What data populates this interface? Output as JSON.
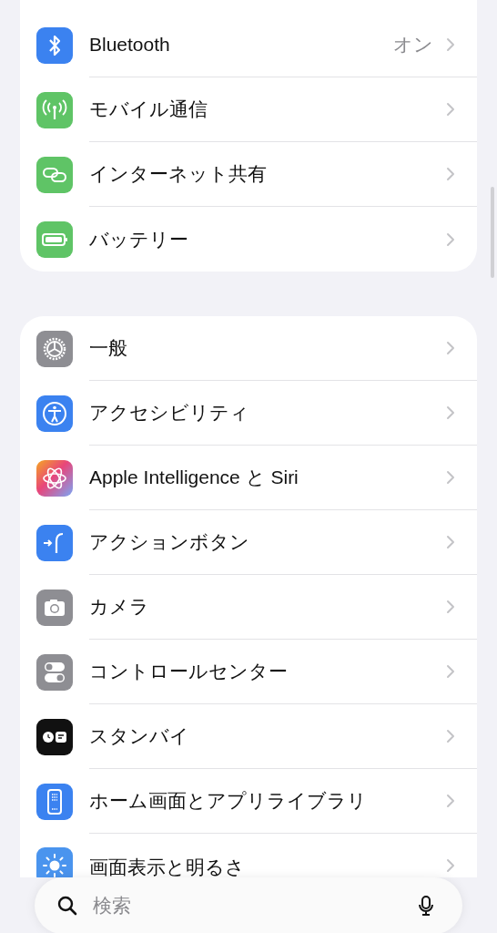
{
  "groups": [
    {
      "items": [
        {
          "label": "Bluetooth",
          "value": "オン",
          "kind": "bluetooth"
        },
        {
          "label": "モバイル通信",
          "kind": "antenna"
        },
        {
          "label": "インターネット共有",
          "kind": "link"
        },
        {
          "label": "バッテリー",
          "kind": "battery"
        }
      ]
    },
    {
      "items": [
        {
          "label": "一般",
          "kind": "gear"
        },
        {
          "label": "アクセシビリティ",
          "kind": "accessibility"
        },
        {
          "label": "Apple Intelligence と Siri",
          "kind": "intelligence"
        },
        {
          "label": "アクションボタン",
          "kind": "action"
        },
        {
          "label": "カメラ",
          "kind": "camera"
        },
        {
          "label": "コントロールセンター",
          "kind": "toggles"
        },
        {
          "label": "スタンバイ",
          "kind": "standby"
        },
        {
          "label": "ホーム画面とアプリライブラリ",
          "kind": "homescreen"
        },
        {
          "label": "画面表示と明るさ",
          "kind": "brightness"
        }
      ]
    }
  ],
  "search": {
    "placeholder": "検索"
  }
}
